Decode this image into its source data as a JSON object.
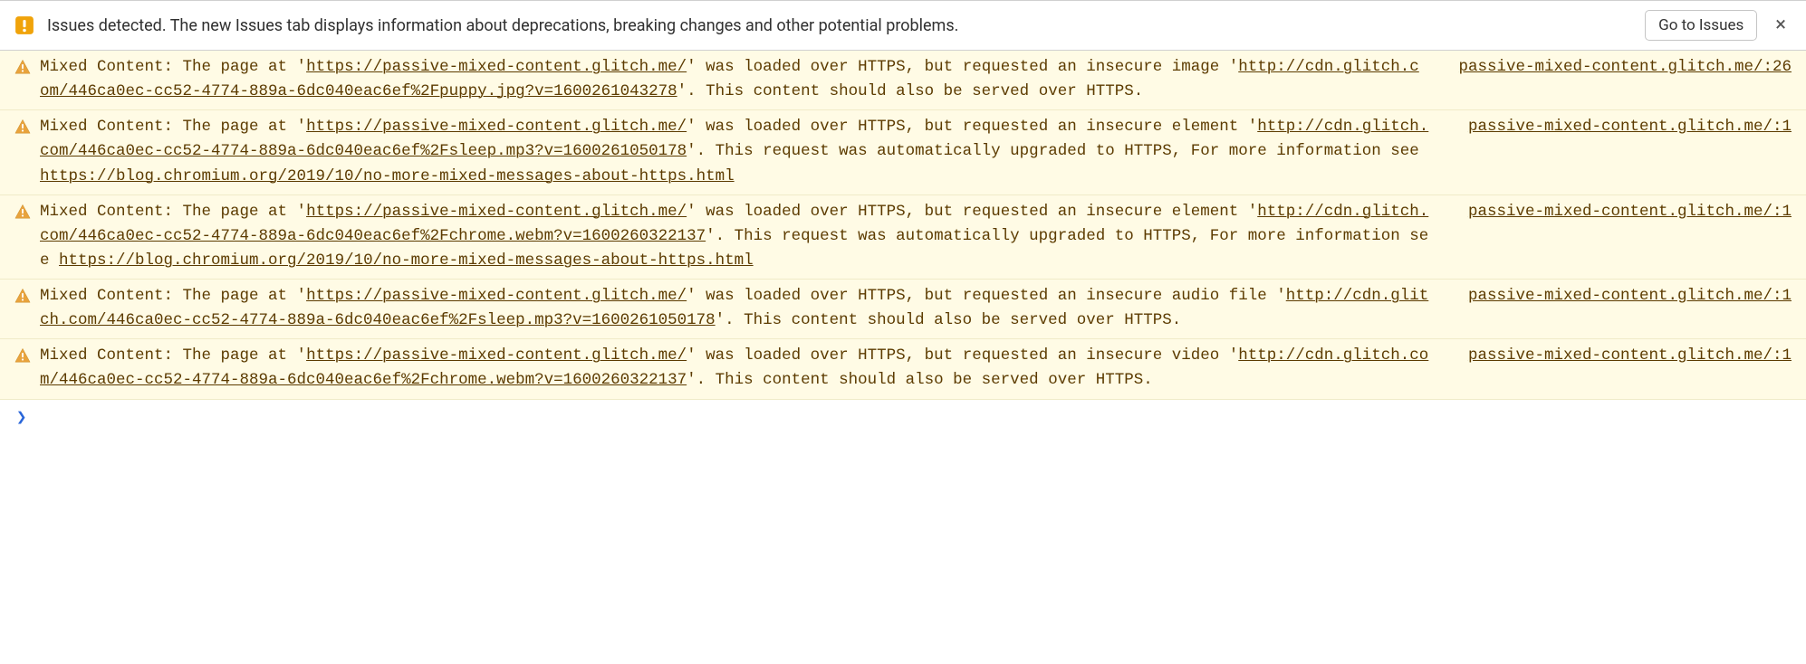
{
  "info_bar": {
    "text": "Issues detected. The new Issues tab displays information about deprecations, breaking changes and other potential problems.",
    "button_label": "Go to Issues",
    "close_label": "×"
  },
  "warnings": [
    {
      "parts": [
        {
          "t": "text",
          "v": "Mixed Content: The page at '"
        },
        {
          "t": "link",
          "v": "https://passive-mixed-content.glitch.me/"
        },
        {
          "t": "text",
          "v": "' was loaded over HTTPS, but requested an insecure image '"
        },
        {
          "t": "link",
          "v": "http://cdn.glitch.com/446ca0ec-cc52-4774-889a-6dc040eac6ef%2Fpuppy.jpg?v=1600261043278"
        },
        {
          "t": "text",
          "v": "'. This content should also be served over HTTPS."
        }
      ],
      "source": "passive-mixed-content.glitch.me/:26"
    },
    {
      "parts": [
        {
          "t": "text",
          "v": "Mixed Content: The page at '"
        },
        {
          "t": "link",
          "v": "https://passive-mixed-content.glitch.me/"
        },
        {
          "t": "text",
          "v": "' was loaded over HTTPS, but requested an insecure element '"
        },
        {
          "t": "link",
          "v": "http://cdn.glitch.com/446ca0ec-cc52-4774-889a-6dc040eac6ef%2Fsleep.mp3?v=1600261050178"
        },
        {
          "t": "text",
          "v": "'. This request was automatically upgraded to HTTPS, For more information see "
        },
        {
          "t": "link",
          "v": "https://blog.chromium.org/2019/10/no-more-mixed-messages-about-https.html"
        }
      ],
      "source": "passive-mixed-content.glitch.me/:1"
    },
    {
      "parts": [
        {
          "t": "text",
          "v": "Mixed Content: The page at '"
        },
        {
          "t": "link",
          "v": "https://passive-mixed-content.glitch.me/"
        },
        {
          "t": "text",
          "v": "' was loaded over HTTPS, but requested an insecure element '"
        },
        {
          "t": "link",
          "v": "http://cdn.glitch.com/446ca0ec-cc52-4774-889a-6dc040eac6ef%2Fchrome.webm?v=1600260322137"
        },
        {
          "t": "text",
          "v": "'. This request was automatically upgraded to HTTPS, For more information see "
        },
        {
          "t": "link",
          "v": "https://blog.chromium.org/2019/10/no-more-mixed-messages-about-https.html"
        }
      ],
      "source": "passive-mixed-content.glitch.me/:1"
    },
    {
      "parts": [
        {
          "t": "text",
          "v": "Mixed Content: The page at '"
        },
        {
          "t": "link",
          "v": "https://passive-mixed-content.glitch.me/"
        },
        {
          "t": "text",
          "v": "' was loaded over HTTPS, but requested an insecure audio file '"
        },
        {
          "t": "link",
          "v": "http://cdn.glitch.com/446ca0ec-cc52-4774-889a-6dc040eac6ef%2Fsleep.mp3?v=1600261050178"
        },
        {
          "t": "text",
          "v": "'. This content should also be served over HTTPS."
        }
      ],
      "source": "passive-mixed-content.glitch.me/:1"
    },
    {
      "parts": [
        {
          "t": "text",
          "v": "Mixed Content: The page at '"
        },
        {
          "t": "link",
          "v": "https://passive-mixed-content.glitch.me/"
        },
        {
          "t": "text",
          "v": "' was loaded over HTTPS, but requested an insecure video '"
        },
        {
          "t": "link",
          "v": "http://cdn.glitch.com/446ca0ec-cc52-4774-889a-6dc040eac6ef%2Fchrome.webm?v=1600260322137"
        },
        {
          "t": "text",
          "v": "'. This content should also be served over HTTPS."
        }
      ],
      "source": "passive-mixed-content.glitch.me/:1"
    }
  ],
  "prompt_symbol": "❯"
}
